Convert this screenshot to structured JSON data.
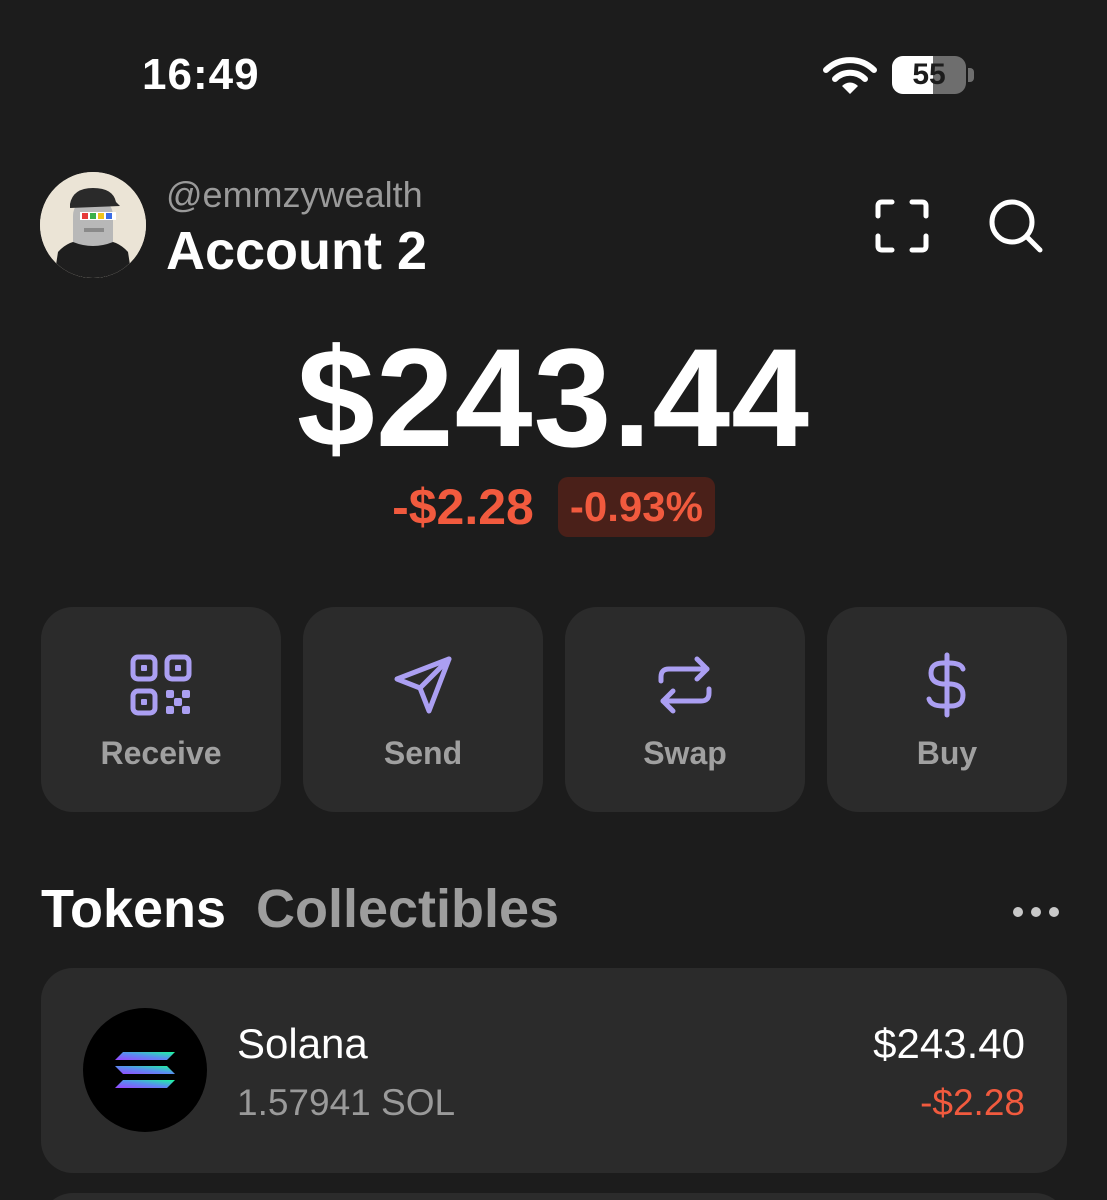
{
  "status_bar": {
    "time": "16:49",
    "battery_percent": 55,
    "battery_label": "55",
    "icons": [
      "wifi-icon",
      "battery-icon"
    ]
  },
  "header": {
    "handle": "@emmzywealth",
    "account_name": "Account 2",
    "icons": [
      "scan-icon",
      "search-icon"
    ]
  },
  "balance": {
    "total": "$243.44",
    "change_amount": "-$2.28",
    "change_percent": "-0.93%"
  },
  "actions": [
    {
      "label": "Receive",
      "icon": "qr-code-icon"
    },
    {
      "label": "Send",
      "icon": "send-icon"
    },
    {
      "label": "Swap",
      "icon": "swap-icon"
    },
    {
      "label": "Buy",
      "icon": "dollar-icon"
    }
  ],
  "tabs": {
    "active": "Tokens",
    "items": [
      "Tokens",
      "Collectibles"
    ]
  },
  "tokens": [
    {
      "name": "Solana",
      "amount": "1.57941 SOL",
      "value": "$243.40",
      "change": "-$2.28",
      "icon": "solana-logo-icon"
    }
  ],
  "colors": {
    "background": "#1c1c1c",
    "card": "#2b2b2b",
    "accent_purple": "#ab9ff2",
    "negative": "#f15a3e",
    "negative_bg": "#4a2019",
    "muted_text": "#9a9a9a"
  }
}
